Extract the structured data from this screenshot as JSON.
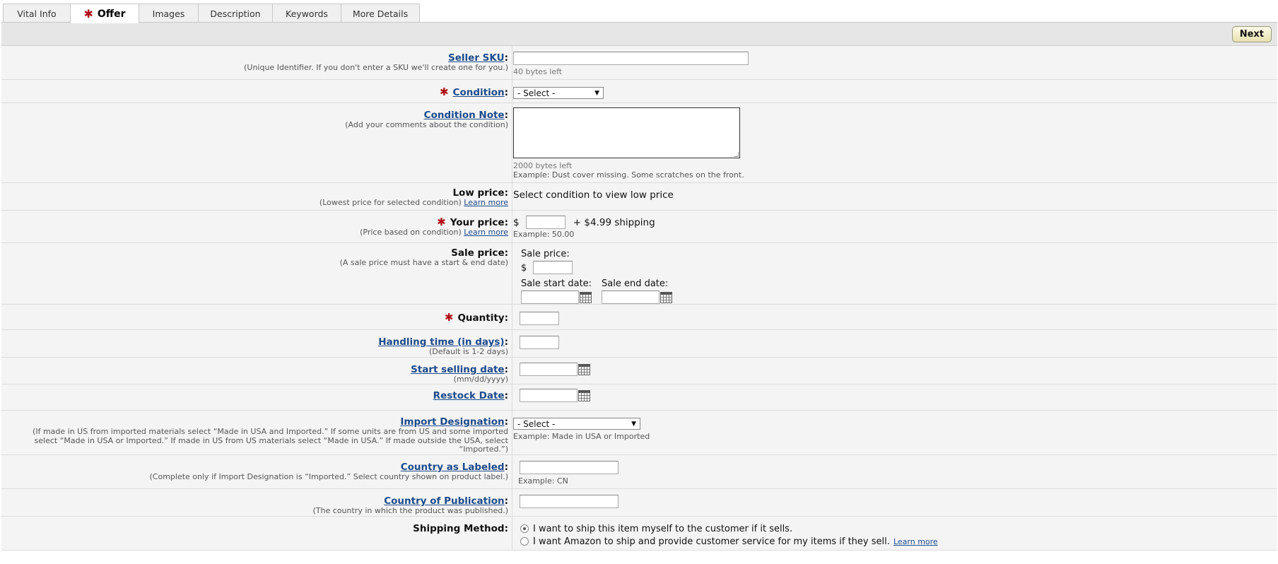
{
  "tabs": [
    {
      "label": "Vital Info",
      "required": false,
      "active": false
    },
    {
      "label": "Offer",
      "required": true,
      "active": true
    },
    {
      "label": "Images",
      "required": false,
      "active": false
    },
    {
      "label": "Description",
      "required": false,
      "active": false
    },
    {
      "label": "Keywords",
      "required": false,
      "active": false
    },
    {
      "label": "More Details",
      "required": false,
      "active": false
    }
  ],
  "required_marker": "✱",
  "header": {
    "next_label": "Next"
  },
  "colon": ":",
  "seller_sku": {
    "label": "Seller SKU",
    "sub": "(Unique Identifier. If you don't enter a SKU we'll create one for you.)",
    "value": "",
    "hint": "40 bytes left"
  },
  "condition": {
    "label": "Condition",
    "selected": "- Select -"
  },
  "condition_note": {
    "label": "Condition Note",
    "sub": "(Add your comments about the condition)",
    "value": "",
    "hint1": "2000 bytes left",
    "hint2": "Example: Dust cover missing. Some scratches on the front."
  },
  "low_price": {
    "label": "Low price:",
    "sub": "(Lowest price for selected condition)",
    "learn_more": "Learn more",
    "value": "Select condition to view low price"
  },
  "your_price": {
    "label": "Your price:",
    "sub": "(Price based on condition)",
    "learn_more": "Learn more",
    "currency": "$",
    "value": "",
    "shipping": "+ $4.99  shipping",
    "hint": "Example: 50.00"
  },
  "sale_price": {
    "label": "Sale price:",
    "sub": "(A sale price must have a start & end date)",
    "field_label": "Sale price:",
    "currency": "$",
    "start_label": "Sale start date:",
    "end_label": "Sale end date:"
  },
  "quantity": {
    "label": "Quantity:",
    "value": ""
  },
  "handling_time": {
    "label": "Handling time (in days)",
    "sub": "(Default is 1-2 days)",
    "value": ""
  },
  "start_selling": {
    "label": "Start selling date",
    "sub": "(mm/dd/yyyy)",
    "value": ""
  },
  "restock": {
    "label": "Restock Date",
    "value": ""
  },
  "import_designation": {
    "label": "Import Designation",
    "sub_line1": "(If made in US from imported materials select “Made in USA and Imported.” If some units are from US and some imported",
    "sub_line2": "select “Made in USA or Imported.” If made in US from US materials select “Made in USA.” If made outside the USA, select",
    "sub_line3": "“Imported.”)",
    "selected": "- Select -",
    "hint": "Example: Made in USA or Imported"
  },
  "country_labeled": {
    "label": "Country as Labeled",
    "sub": "(Complete only if Import Designation is “Imported.” Select country shown on product label.)",
    "hint": "Example: CN"
  },
  "country_publication": {
    "label": "Country of Publication",
    "sub": "(The country in which the product was published.)"
  },
  "shipping_method": {
    "label": "Shipping Method:",
    "option1": "I want to ship this item myself to the customer if it sells.",
    "option2": "I want Amazon to ship and provide customer service for my items if they sell.",
    "learn_more": "Learn more",
    "selected": 1
  },
  "colors": {
    "required": "#b0101a",
    "link": "#1c4a8a",
    "row_bg": "#f4f4f4",
    "header_bg": "#e6e6e6"
  }
}
